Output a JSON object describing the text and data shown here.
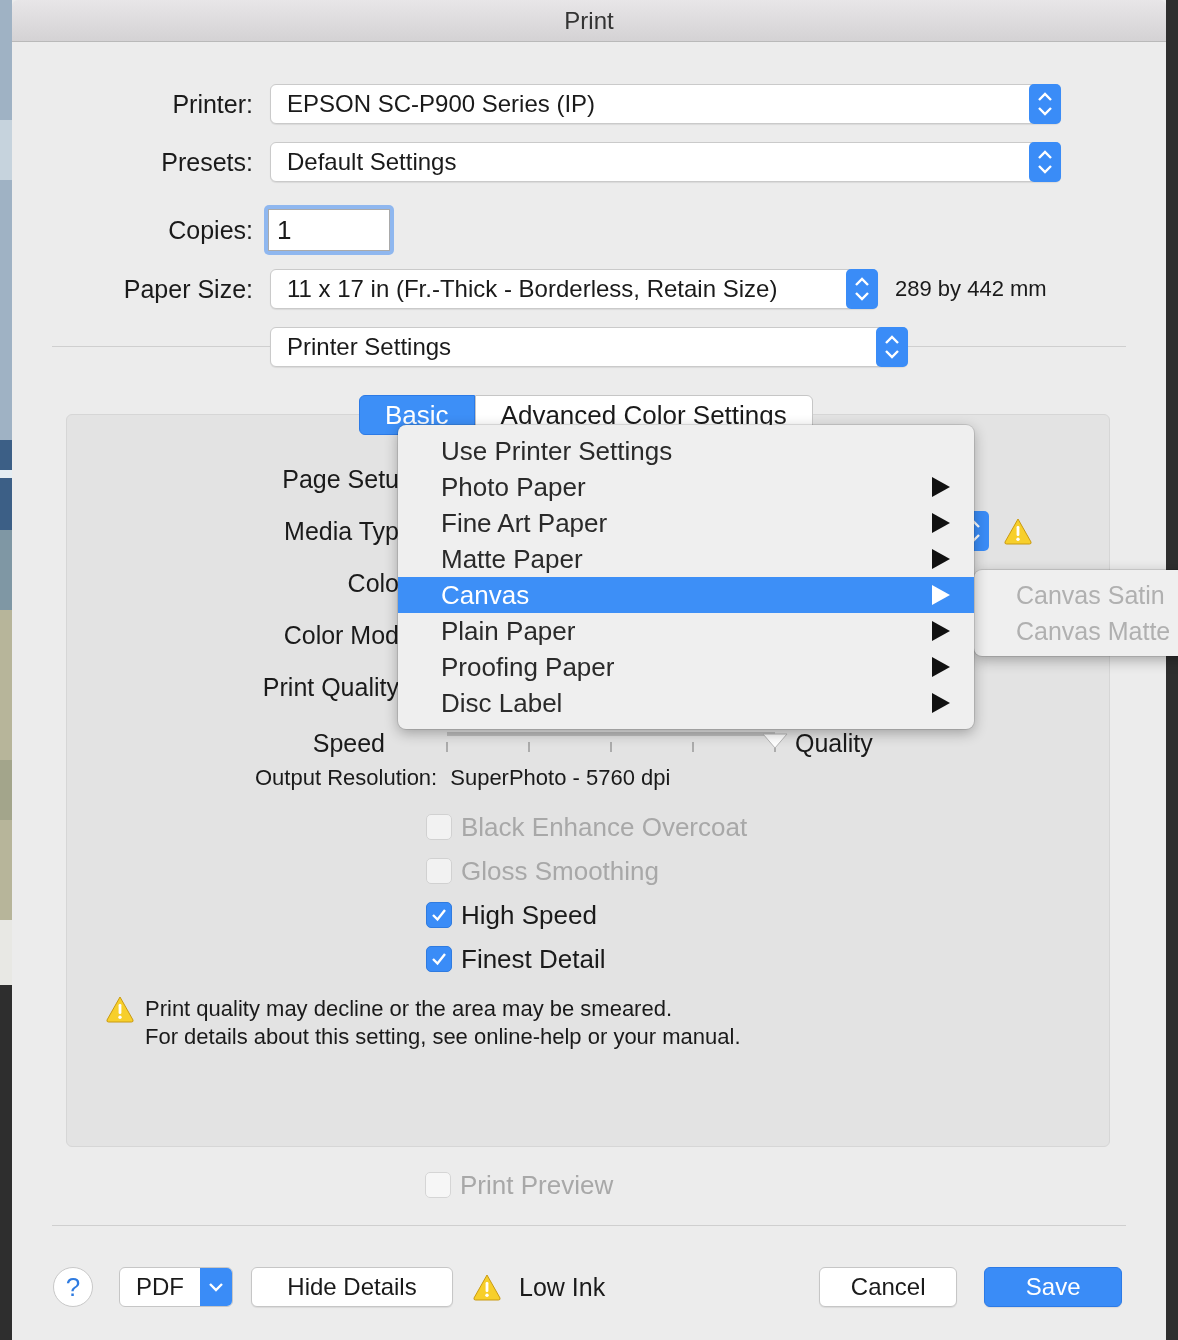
{
  "window": {
    "title": "Print"
  },
  "printer": {
    "label": "Printer:",
    "value": "EPSON SC-P900 Series (IP)"
  },
  "presets": {
    "label": "Presets:",
    "value": "Default Settings"
  },
  "copies": {
    "label": "Copies:",
    "value": "1"
  },
  "paper_size": {
    "label": "Paper Size:",
    "value": "11 x 17 in (Fr.-Thick - Borderless, Retain Size)",
    "dimensions": "289 by 442 mm"
  },
  "section": {
    "value": "Printer Settings"
  },
  "tabs": [
    {
      "label": "Basic",
      "selected": true
    },
    {
      "label": "Advanced Color Settings",
      "selected": false
    }
  ],
  "settings": {
    "rows": [
      {
        "label": "Page Setu",
        "kind": "label",
        "warning": false
      },
      {
        "label": "Media Typ",
        "kind": "popup",
        "warning": true
      },
      {
        "label": "Colo",
        "kind": "label",
        "warning": false
      },
      {
        "label": "Color Mod",
        "kind": "label",
        "warning": false
      },
      {
        "label": "Print Quality",
        "kind": "label",
        "warning": false
      }
    ],
    "speed": {
      "label": "Speed",
      "level": 1,
      "end_label": "Quality"
    },
    "output_resolution": {
      "label": "Output Resolution:",
      "value": "SuperPhoto - 5760 dpi"
    },
    "options": [
      {
        "label": "Black Enhance Overcoat",
        "checked": false,
        "disabled": true
      },
      {
        "label": "Gloss Smoothing",
        "checked": false,
        "disabled": true
      },
      {
        "label": "High Speed",
        "checked": true,
        "disabled": false
      },
      {
        "label": "Finest Detail",
        "checked": true,
        "disabled": false
      }
    ],
    "notice": [
      "Print quality may decline or the area may be smeared.",
      "For details about this setting, see online-help or your manual."
    ]
  },
  "print_preview": {
    "label": "Print Preview",
    "checked": false,
    "disabled": true
  },
  "media_menu": {
    "items": [
      {
        "label": "Use Printer Settings",
        "submenu": false,
        "selected": false
      },
      {
        "label": "Photo Paper",
        "submenu": true,
        "selected": false
      },
      {
        "label": "Fine Art Paper",
        "submenu": true,
        "selected": false
      },
      {
        "label": "Matte Paper",
        "submenu": true,
        "selected": false
      },
      {
        "label": "Canvas",
        "submenu": true,
        "selected": true
      },
      {
        "label": "Plain Paper",
        "submenu": true,
        "selected": false
      },
      {
        "label": "Proofing Paper",
        "submenu": true,
        "selected": false
      },
      {
        "label": "Disc Label",
        "submenu": true,
        "selected": false
      }
    ]
  },
  "submenu": {
    "items": [
      {
        "label": "Canvas Satin",
        "disabled": true
      },
      {
        "label": "Canvas Matte",
        "disabled": true
      }
    ]
  },
  "footer": {
    "help": "?",
    "pdf": "PDF",
    "hide_details": "Hide Details",
    "status": "Low Ink",
    "status_warning": true,
    "cancel": "Cancel",
    "save": "Save"
  }
}
